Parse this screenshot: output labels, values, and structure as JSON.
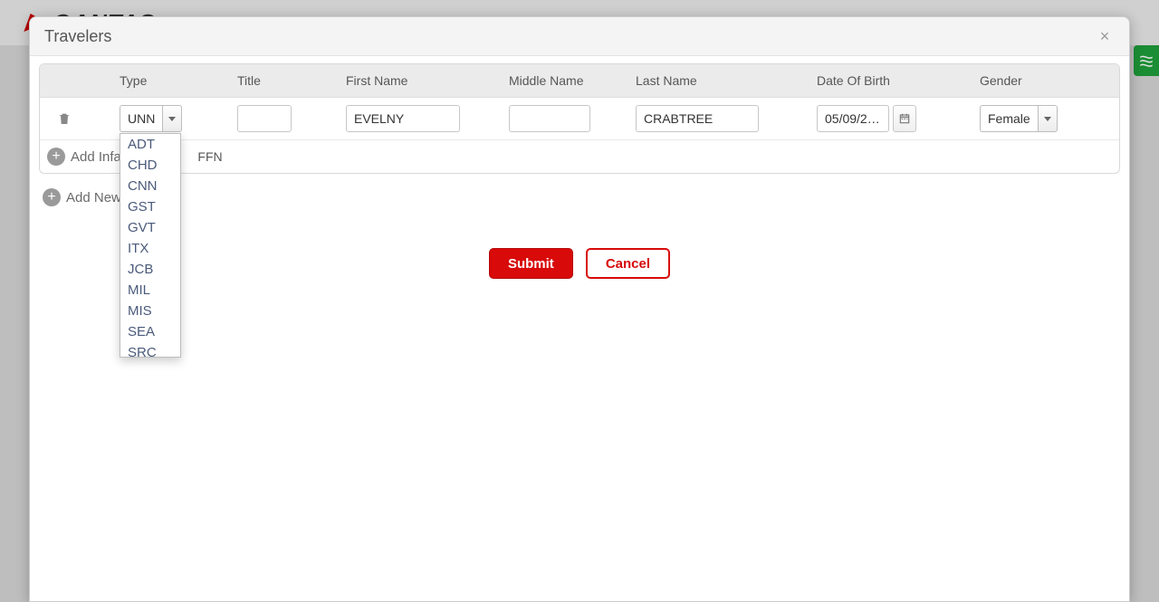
{
  "brand": "QANTAS",
  "modal": {
    "title": "Travelers",
    "close_label": "×"
  },
  "columns": {
    "type": "Type",
    "title": "Title",
    "first_name": "First Name",
    "middle_name": "Middle Name",
    "last_name": "Last Name",
    "dob": "Date Of Birth",
    "gender": "Gender"
  },
  "row": {
    "type_value": "UNN",
    "title_value": "",
    "first_name": "EVELNY",
    "middle_name": "",
    "last_name": "CRABTREE",
    "dob": "05/09/2…",
    "gender": "Female"
  },
  "type_options": [
    "ADT",
    "CHD",
    "CNN",
    "GST",
    "GVT",
    "ITX",
    "JCB",
    "MIL",
    "MIS",
    "SEA",
    "SRC"
  ],
  "links": {
    "add_infant": "Add Infant",
    "ffn": "FFN",
    "add_new": "Add New"
  },
  "buttons": {
    "submit": "Submit",
    "cancel": "Cancel"
  }
}
